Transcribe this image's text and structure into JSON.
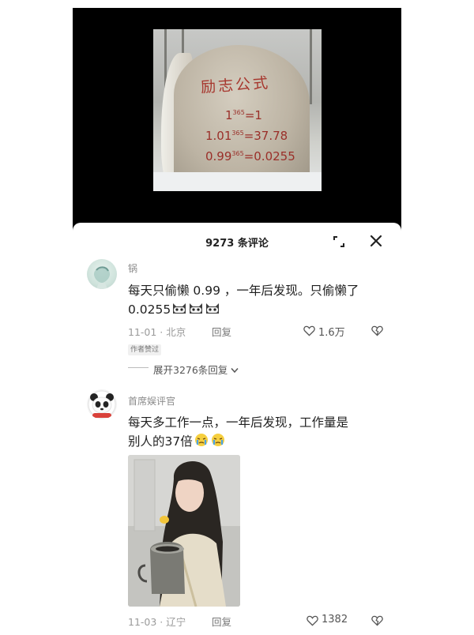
{
  "video": {
    "stone_title": "励志公式",
    "equations": [
      {
        "base": "1",
        "exp": "365",
        "result": "1"
      },
      {
        "base": "1.01",
        "exp": "365",
        "result": "37.78"
      },
      {
        "base": "0.99",
        "exp": "365",
        "result": "0.0255"
      }
    ]
  },
  "sheet": {
    "title": "9273 条评论",
    "expand_icon": "expand-corner-icon",
    "close_icon": "close-icon"
  },
  "comments": [
    {
      "username": "锅",
      "text_line1": "每天只偷懒 0.99 ，一年后发现。只偷懒了",
      "text_line2": "0.0255",
      "emoji_count": 3,
      "date": "11-01",
      "location": "北京",
      "reply_label": "回复",
      "likes": "1.6万",
      "badge": "作者赞过",
      "expand_replies": "展开3276条回复"
    },
    {
      "username": "首席娱评官",
      "text_line1": "每天多工作一点，一年后发现，工作量是",
      "text_line2": "别人的37倍",
      "emoji_count": 2,
      "date": "11-03",
      "location": "辽宁",
      "reply_label": "回复",
      "likes": "1382"
    }
  ],
  "colors": {
    "stone_text": "#a7372e",
    "meta_text": "#9a9a9a"
  }
}
